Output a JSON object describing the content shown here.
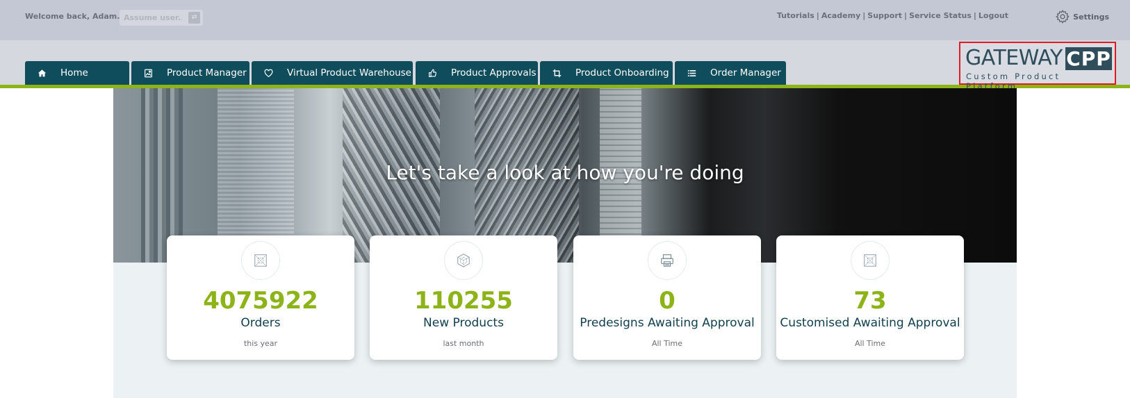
{
  "topbar": {
    "welcome": "Welcome back, Adam...",
    "assume_placeholder": "Assume user...",
    "links": [
      "Tutorials",
      "Academy",
      "Support",
      "Service Status",
      "Logout"
    ],
    "settings_label": "Settings"
  },
  "nav": {
    "tabs": [
      {
        "label": "Home",
        "icon": "home-icon"
      },
      {
        "label": "Product Manager",
        "icon": "image-icon"
      },
      {
        "label": "Virtual Product Warehouse",
        "icon": "heart-icon"
      },
      {
        "label": "Product Approvals",
        "icon": "thumbs-up-icon"
      },
      {
        "label": "Product Onboarding",
        "icon": "crop-icon"
      },
      {
        "label": "Order Manager",
        "icon": "list-icon"
      }
    ],
    "accent": "#8cb419",
    "tab_color": "#0f4d5c"
  },
  "logo": {
    "text_gateway": "GATEWAY",
    "text_cpp": "CPP",
    "tagline": "Custom Product Platform"
  },
  "hero": {
    "title": "Let's take a look at how you're doing"
  },
  "stats": [
    {
      "value": "4075922",
      "label": "Orders",
      "period": "this year",
      "icon": "box-icon"
    },
    {
      "value": "110255",
      "label": "New Products",
      "period": "last month",
      "icon": "cube-icon"
    },
    {
      "value": "0",
      "label": "Predesigns Awaiting Approval",
      "period": "All Time",
      "icon": "printer-icon"
    },
    {
      "value": "73",
      "label": "Customised Awaiting Approval",
      "period": "All Time",
      "icon": "box-icon"
    }
  ]
}
